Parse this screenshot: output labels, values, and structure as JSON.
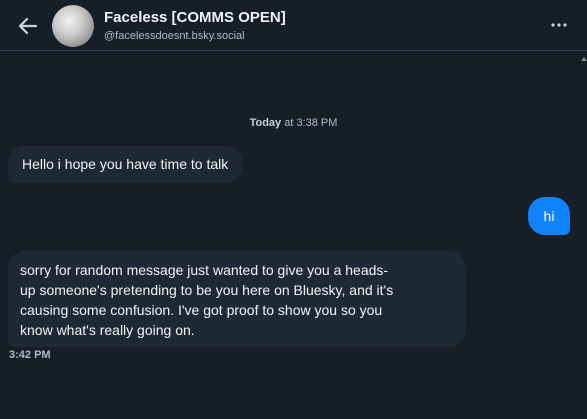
{
  "header": {
    "title": "Faceless [COMMS OPEN]",
    "handle": "@facelessdoesnt.bsky.social",
    "back_icon": "arrow-left-icon",
    "more_icon": "ellipsis-icon"
  },
  "conversation": {
    "day_label": "Today",
    "day_time": " at 3:38 PM",
    "messages": [
      {
        "from": "them",
        "text": "Hello i hope you have time to talk"
      },
      {
        "from": "me",
        "text": "hi"
      },
      {
        "from": "them",
        "lines": [
          "sorry for random message just wanted to give you a heads-",
          "up someone's pretending to be you here on Bluesky, and it's",
          "causing some confusion. I've got proof to show you so you",
          "know what's really going on."
        ]
      }
    ],
    "last_time": "3:42 PM"
  },
  "colors": {
    "background": "#161e27",
    "incoming_bubble": "#1e2937",
    "outgoing_bubble": "#1083fe",
    "divider": "#2e4052"
  }
}
